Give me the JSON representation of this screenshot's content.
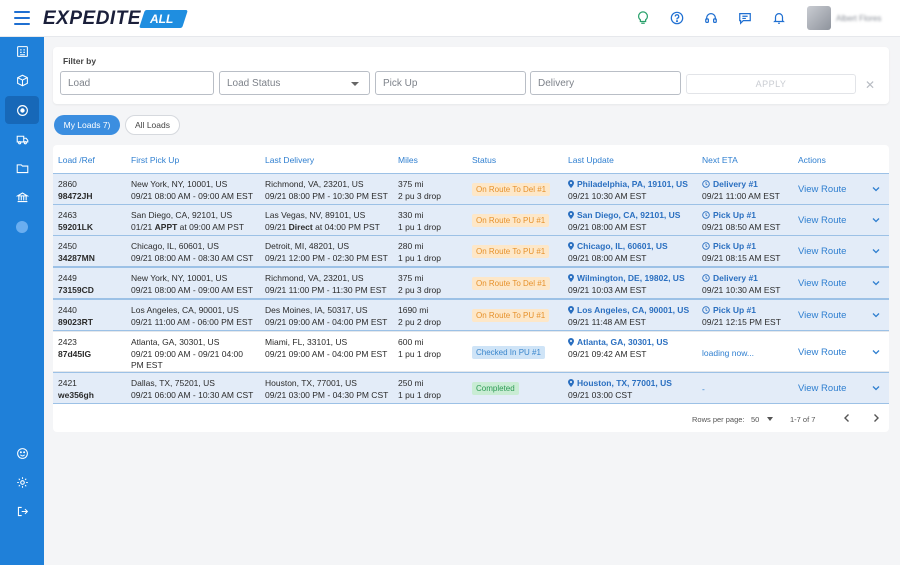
{
  "brand": {
    "main": "EXPEDITE",
    "badge": "ALL"
  },
  "header": {
    "user_name": "Albert Flores"
  },
  "filter": {
    "title": "Filter by",
    "load_placeholder": "Load",
    "load_status_placeholder": "Load Status",
    "pickup_placeholder": "Pick Up",
    "delivery_placeholder": "Delivery",
    "apply_label": "APPLY",
    "close_glyph": "✕"
  },
  "tabs": {
    "my_loads": "My Loads 7)",
    "all_loads": "All Loads"
  },
  "table": {
    "headers": [
      "Load /Ref",
      "First Pick Up",
      "Last Delivery",
      "Miles",
      "Status",
      "Last Update",
      "Next ETA",
      "Actions"
    ],
    "action_label": "View Route",
    "rows": [
      {
        "id": "2860",
        "ref": "98472JH",
        "pu_loc": "New York, NY, 10001, US",
        "pu_time": "09/21 08:00 AM - 09:00 AM EST",
        "del_loc": "Richmond, VA, 23201, US",
        "del_time": "09/21 08:00 PM - 10:30 PM EST",
        "miles": "375 mi",
        "stops": "2 pu 3 drop",
        "status": "On Route To Del #1",
        "status_color": "orange",
        "update_loc": "Philadelphia, PA, 19101, US",
        "update_time": "09/21 10:30 AM EST",
        "eta_label": "Delivery #1",
        "eta_time": "09/21 11:00 AM EST"
      },
      {
        "id": "2463",
        "ref": "59201LK",
        "pu_loc": "San Diego, CA, 92101, US",
        "pu_time_pre": "01/21 ",
        "pu_time_bold": "APPT",
        "pu_time_post": " at 09:00 AM PST",
        "del_loc": "Las Vegas, NV, 89101, US",
        "del_time_pre": "09/21 ",
        "del_time_bold": "Direct",
        "del_time_post": " at 04:00 PM PST",
        "miles": "330 mi",
        "stops": "1 pu 1 drop",
        "status": "On Route To PU #1",
        "status_color": "orange",
        "update_loc": "San Diego, CA, 92101, US",
        "update_time": "09/21 08:00 AM EST",
        "eta_label": "Pick Up #1",
        "eta_time": "09/21 08:50 AM EST"
      },
      {
        "id": "2450",
        "ref": "34287MN",
        "pu_loc": "Chicago, IL, 60601, US",
        "pu_time": "09/21 08:00 AM - 08:30 AM CST",
        "del_loc": "Detroit, MI, 48201, US",
        "del_time": "09/21 12:00 PM - 02:30 PM EST",
        "miles": "280 mi",
        "stops": "1 pu 1 drop",
        "status": "On Route To PU #1",
        "status_color": "orange",
        "update_loc": "Chicago, IL, 60601, US",
        "update_time": "09/21 08:00 AM EST",
        "eta_label": "Pick Up #1",
        "eta_time": "09/21 08:15 AM EST"
      },
      {
        "id": "2449",
        "ref": "73159CD",
        "pu_loc": "New York, NY, 10001, US",
        "pu_time": "09/21 08:00 AM - 09:00 AM EST",
        "del_loc": "Richmond, VA, 23201, US",
        "del_time": "09/21 11:00 PM - 11:30 PM EST",
        "miles": "375 mi",
        "stops": "2 pu 3 drop",
        "status": "On Route To Del #1",
        "status_color": "orange",
        "update_loc": "Wilmington, DE, 19802, US",
        "update_time": "09/21 10:03 AM EST",
        "eta_label": "Delivery #1",
        "eta_time": "09/21 10:30 AM EST"
      },
      {
        "id": "2440",
        "ref": "89023RT",
        "pu_loc": "Los Angeles, CA, 90001, US",
        "pu_time": "09/21 11:00 AM - 06:00 PM EST",
        "del_loc": "Des Moines, IA, 50317, US",
        "del_time": "09/21 09:00 AM - 04:00 PM EST",
        "miles": "1690 mi",
        "stops": "2 pu 2 drop",
        "status": "On Route To PU #1",
        "status_color": "orange",
        "update_loc": "Los Angeles, CA, 90001, US",
        "update_time": "09/21 11:48 AM EST",
        "eta_label": "Pick Up #1",
        "eta_time": "09/21 12:15 PM EST"
      },
      {
        "id": "2423",
        "ref": "87d45IG",
        "pu_loc": "Atlanta, GA, 30301, US",
        "pu_time": "09/21 09:00 AM - 09/21 04:00",
        "pu_time2": "PM EST",
        "del_loc": "Miami, FL, 33101, US",
        "del_time": "09/21 09:00 AM - 04:00 PM EST",
        "miles": "600 mi",
        "stops": "1 pu 1 drop",
        "status": "Checked In PU #1",
        "status_color": "lightblue",
        "update_loc": "Atlanta, GA, 30301, US",
        "update_time": "09/21 09:42 AM EST",
        "eta_loading": "loading now..."
      },
      {
        "id": "2421",
        "ref": "we356gh",
        "pu_loc": "Dallas, TX, 75201, US",
        "pu_time": "09/21 06:00 AM - 10:30 AM CST",
        "del_loc": "Houston, TX, 77001, US",
        "del_time": "09/21 03:00 PM - 04:30 PM CST",
        "miles": "250 mi",
        "stops": "1 pu 1 drop",
        "status": "Completed",
        "status_color": "green",
        "update_loc": "Houston, TX, 77001, US",
        "update_time": "09/21 03:00 CST",
        "eta_dash": "-"
      }
    ]
  },
  "pagination": {
    "rows_label": "Rows per page:",
    "rows_value": "50",
    "range": "1-7 of 7"
  },
  "colors": {
    "brand_blue": "#1f80d9",
    "orange": "#e6912b",
    "green": "#2c9a54",
    "link": "#2f7fd0"
  }
}
